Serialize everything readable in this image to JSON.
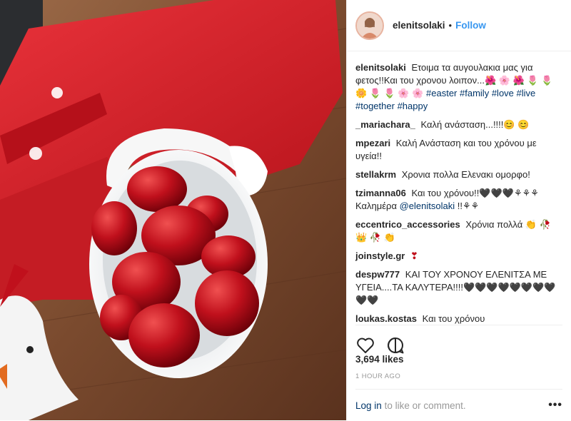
{
  "post": {
    "username": "elenitsolaki",
    "separator": "•",
    "follow_label": "Follow",
    "caption_user": "elenitsolaki",
    "caption_text": "Ετοιμα τα αυγουλακια μας για φετος!!Και του χρονου λοιπον...🌺 🌸 🌺 🌷 🌷 🌼 🌷 🌷 🌸 🌸",
    "hashtags": [
      "#easter",
      "#family",
      "#love",
      "#live",
      "#together",
      "#happy"
    ],
    "likes": "3,694 likes",
    "time": "1 HOUR AGO"
  },
  "comments": [
    {
      "user": "_mariachara_",
      "text": "Καλή ανάσταση...!!!!😊 😊"
    },
    {
      "user": "mpezari",
      "text": "Καλή Ανάσταση και του χρόνου με υγεία!!"
    },
    {
      "user": "stellakrm",
      "text": "Χρονια πολλα Ελενακι ομορφο!"
    },
    {
      "user": "tzimanna06",
      "text": "Και του χρόνου!!🖤🖤🖤⚘⚘⚘ Καλημέρα",
      "mention": "@elenitsolaki",
      "text2": "!!⚘⚘"
    },
    {
      "user": "eccentrico_accessories",
      "text": "Χρόνια πολλά 👏 🥀 👑 🥀 👏"
    },
    {
      "user": "joinstyle.gr",
      "text": "❣"
    },
    {
      "user": "despw777",
      "text": "ΚΑΙ ΤΟΥ ΧΡΟΝΟΥ ΕΛΕΝΙΤΣΑ ΜΕ ΥΓΕΙΑ....ΤΑ ΚΑΛΥΤΕΡΑ!!!!🖤🖤🖤🖤🖤🖤🖤🖤🖤🖤"
    },
    {
      "user": "loukas.kostas",
      "text": "Και του χρόνου"
    }
  ],
  "footer": {
    "login_link": "Log in",
    "login_rest": "to like or comment.",
    "more": "•••"
  },
  "icons": {
    "like": "heart-icon",
    "comment": "comment-icon",
    "more": "more-options-icon"
  },
  "colors": {
    "link": "#3897f0",
    "hashtag": "#003569",
    "muted": "#999999",
    "egg_red": "#c0101c",
    "cloth_red": "#d9262e"
  }
}
